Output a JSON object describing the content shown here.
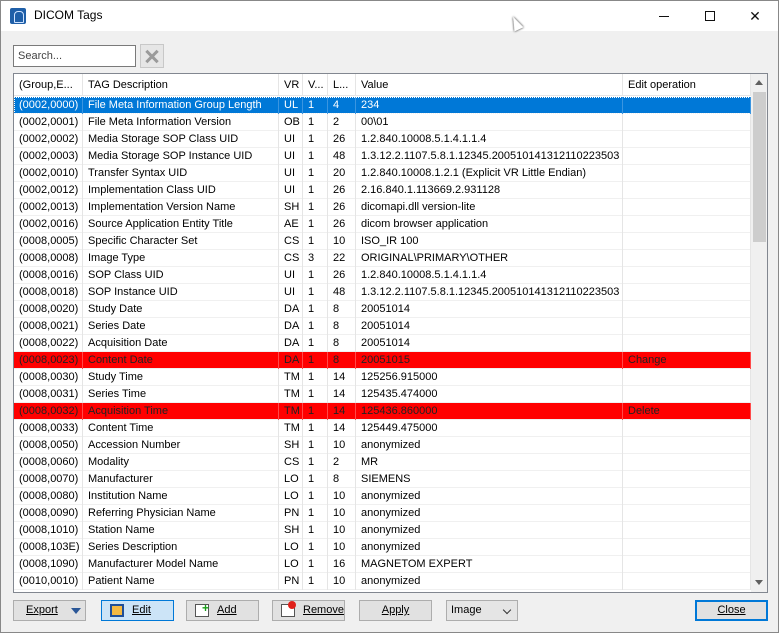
{
  "window": {
    "title": "DICOM Tags"
  },
  "search": {
    "placeholder": "Search..."
  },
  "columns": [
    "(Group,E...",
    "TAG Description",
    "VR",
    "V...",
    "L...",
    "Value",
    "Edit operation"
  ],
  "rows": [
    [
      "(0002,0000)",
      "File Meta Information Group Length",
      "UL",
      "1",
      "4",
      "234",
      ""
    ],
    [
      "(0002,0001)",
      "File Meta Information Version",
      "OB",
      "1",
      "2",
      "00\\01",
      ""
    ],
    [
      "(0002,0002)",
      "Media Storage SOP Class UID",
      "UI",
      "1",
      "26",
      "1.2.840.10008.5.1.4.1.1.4",
      ""
    ],
    [
      "(0002,0003)",
      "Media Storage SOP Instance UID",
      "UI",
      "1",
      "48",
      "1.3.12.2.1107.5.8.1.12345.200510141312110223503",
      ""
    ],
    [
      "(0002,0010)",
      "Transfer Syntax UID",
      "UI",
      "1",
      "20",
      "1.2.840.10008.1.2.1 (Explicit VR Little Endian)",
      ""
    ],
    [
      "(0002,0012)",
      "Implementation Class UID",
      "UI",
      "1",
      "26",
      "2.16.840.1.113669.2.931128",
      ""
    ],
    [
      "(0002,0013)",
      "Implementation Version Name",
      "SH",
      "1",
      "26",
      "dicomapi.dll version-lite",
      ""
    ],
    [
      "(0002,0016)",
      "Source Application Entity Title",
      "AE",
      "1",
      "26",
      "dicom browser application",
      ""
    ],
    [
      "(0008,0005)",
      "Specific Character Set",
      "CS",
      "1",
      "10",
      "ISO_IR 100",
      ""
    ],
    [
      "(0008,0008)",
      "Image Type",
      "CS",
      "3",
      "22",
      "ORIGINAL\\PRIMARY\\OTHER",
      ""
    ],
    [
      "(0008,0016)",
      "SOP Class UID",
      "UI",
      "1",
      "26",
      "1.2.840.10008.5.1.4.1.1.4",
      ""
    ],
    [
      "(0008,0018)",
      "SOP Instance UID",
      "UI",
      "1",
      "48",
      "1.3.12.2.1107.5.8.1.12345.200510141312110223503",
      ""
    ],
    [
      "(0008,0020)",
      "Study Date",
      "DA",
      "1",
      "8",
      "20051014",
      ""
    ],
    [
      "(0008,0021)",
      "Series Date",
      "DA",
      "1",
      "8",
      "20051014",
      ""
    ],
    [
      "(0008,0022)",
      "Acquisition Date",
      "DA",
      "1",
      "8",
      "20051014",
      ""
    ],
    [
      "(0008,0023)",
      "Content Date",
      "DA",
      "1",
      "8",
      "20051015",
      "Change"
    ],
    [
      "(0008,0030)",
      "Study Time",
      "TM",
      "1",
      "14",
      "125256.915000",
      ""
    ],
    [
      "(0008,0031)",
      "Series Time",
      "TM",
      "1",
      "14",
      "125435.474000",
      ""
    ],
    [
      "(0008,0032)",
      "Acquisition Time",
      "TM",
      "1",
      "14",
      "125436.860000",
      "Delete"
    ],
    [
      "(0008,0033)",
      "Content Time",
      "TM",
      "1",
      "14",
      "125449.475000",
      ""
    ],
    [
      "(0008,0050)",
      "Accession Number",
      "SH",
      "1",
      "10",
      "anonymized",
      ""
    ],
    [
      "(0008,0060)",
      "Modality",
      "CS",
      "1",
      "2",
      "MR",
      ""
    ],
    [
      "(0008,0070)",
      "Manufacturer",
      "LO",
      "1",
      "8",
      "SIEMENS",
      ""
    ],
    [
      "(0008,0080)",
      "Institution Name",
      "LO",
      "1",
      "10",
      "anonymized",
      ""
    ],
    [
      "(0008,0090)",
      "Referring Physician Name",
      "PN",
      "1",
      "10",
      "anonymized",
      ""
    ],
    [
      "(0008,1010)",
      "Station Name",
      "SH",
      "1",
      "10",
      "anonymized",
      ""
    ],
    [
      "(0008,103E)",
      "Series Description",
      "LO",
      "1",
      "10",
      "anonymized",
      ""
    ],
    [
      "(0008,1090)",
      "Manufacturer Model Name",
      "LO",
      "1",
      "16",
      "MAGNETOM EXPERT",
      ""
    ],
    [
      "(0010,0010)",
      "Patient Name",
      "PN",
      "1",
      "10",
      "anonymized",
      ""
    ]
  ],
  "toolbar": {
    "export": "Export",
    "edit": "Edit",
    "add": "Add",
    "remove": "Remove",
    "apply": "Apply",
    "image_select": "Image",
    "close": "Close"
  }
}
